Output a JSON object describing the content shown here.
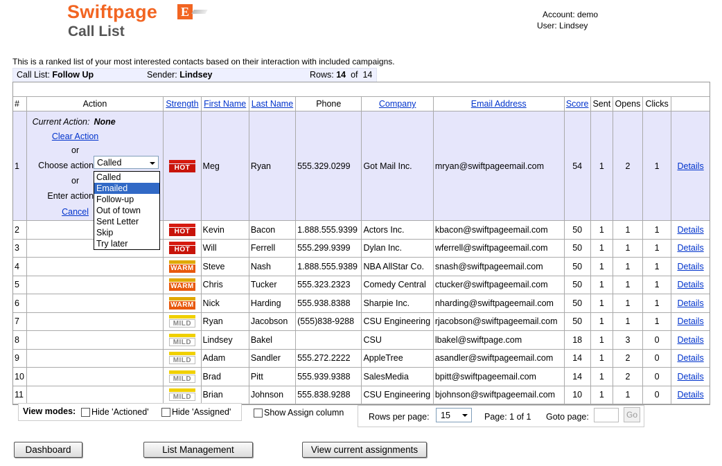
{
  "header": {
    "brand": "Swiftpage",
    "brand_mark": "E",
    "title": "Call List",
    "account_label": "Account:",
    "account": "demo",
    "user_label": "User:",
    "user": "Lindsey"
  },
  "intro": "This is a ranked list of your most interested contacts based on their interaction with included campaigns.",
  "summary": {
    "calllist_label": "Call List:",
    "calllist": "Follow Up",
    "sender_label": "Sender:",
    "sender": "Lindsey",
    "rows_label": "Rows:",
    "rows": "14",
    "of_label": "of",
    "total": "14"
  },
  "columns": [
    "#",
    "Action",
    "Strength",
    "First Name",
    "Last Name",
    "Phone",
    "Company",
    "Email Address",
    "Score",
    "Sent",
    "Opens",
    "Clicks"
  ],
  "action_panel": {
    "current_label": "Current Action:",
    "current_value": "None",
    "clear_label": "Clear Action",
    "or1": "or",
    "choose_label": "Choose action:",
    "or2": "or",
    "enter_label": "Enter action:",
    "cancel_label": "Cancel",
    "selected": "Called",
    "options": [
      "Called",
      "Emailed",
      "Follow-up",
      "Out of town",
      "Sent Letter",
      "Skip",
      "Try later"
    ],
    "highlighted_index": 1
  },
  "details_label": "Details",
  "rows": [
    {
      "num": "1",
      "strength": "HOT",
      "first": "Meg",
      "last": "Ryan",
      "phone": "555.329.0299",
      "company": "Got Mail Inc.",
      "email": "mryan@swiftpageemail.com",
      "score": "54",
      "sent": "1",
      "opens": "2",
      "clicks": "1"
    },
    {
      "num": "2",
      "strength": "HOT",
      "first": "Kevin",
      "last": "Bacon",
      "phone": "1.888.555.9399",
      "company": "Actors Inc.",
      "email": "kbacon@swiftpageemail.com",
      "score": "50",
      "sent": "1",
      "opens": "1",
      "clicks": "1"
    },
    {
      "num": "3",
      "strength": "HOT",
      "first": "Will",
      "last": "Ferrell",
      "phone": "555.299.9399",
      "company": "Dylan Inc.",
      "email": "wferrell@swiftpageemail.com",
      "score": "50",
      "sent": "1",
      "opens": "1",
      "clicks": "1"
    },
    {
      "num": "4",
      "strength": "WARM",
      "first": "Steve",
      "last": "Nash",
      "phone": "1.888.555.9389",
      "company": "NBA AllStar Co.",
      "email": "snash@swiftpageemail.com",
      "score": "50",
      "sent": "1",
      "opens": "1",
      "clicks": "1"
    },
    {
      "num": "5",
      "strength": "WARM",
      "first": "Chris",
      "last": "Tucker",
      "phone": "555.323.2323",
      "company": "Comedy Central",
      "email": "ctucker@swiftpageemail.com",
      "score": "50",
      "sent": "1",
      "opens": "1",
      "clicks": "1"
    },
    {
      "num": "6",
      "strength": "WARM",
      "first": "Nick",
      "last": "Harding",
      "phone": "555.938.8388",
      "company": "Sharpie Inc.",
      "email": "nharding@swiftpageemail.com",
      "score": "50",
      "sent": "1",
      "opens": "1",
      "clicks": "1"
    },
    {
      "num": "7",
      "strength": "MILD",
      "first": "Ryan",
      "last": "Jacobson",
      "phone": "(555)838-9288",
      "company": "CSU Engineering",
      "email": "rjacobson@swiftpageemail.com",
      "score": "50",
      "sent": "1",
      "opens": "1",
      "clicks": "1"
    },
    {
      "num": "8",
      "strength": "MILD",
      "first": "Lindsey",
      "last": "Bakel",
      "phone": "",
      "company": "CSU",
      "email": "lbakel@swiftpage.com",
      "score": "18",
      "sent": "1",
      "opens": "3",
      "clicks": "0"
    },
    {
      "num": "9",
      "strength": "MILD",
      "first": "Adam",
      "last": "Sandler",
      "phone": "555.272.2222",
      "company": "AppleTree",
      "email": "asandler@swiftpageemail.com",
      "score": "14",
      "sent": "1",
      "opens": "2",
      "clicks": "0"
    },
    {
      "num": "10",
      "strength": "MILD",
      "first": "Brad",
      "last": "Pitt",
      "phone": "555.939.9388",
      "company": "SalesMedia",
      "email": "bpitt@swiftpageemail.com",
      "score": "14",
      "sent": "1",
      "opens": "2",
      "clicks": "0"
    },
    {
      "num": "11",
      "strength": "MILD",
      "first": "Brian",
      "last": "Johnson",
      "phone": "555.838.9288",
      "company": "CSU Engineering",
      "email": "bjohnson@swiftpageemail.com",
      "score": "10",
      "sent": "1",
      "opens": "1",
      "clicks": "0"
    }
  ],
  "bottom": {
    "view_modes_label": "View modes:",
    "hide_actioned": "Hide 'Actioned'",
    "hide_assigned": "Hide 'Assigned'",
    "show_assign": "Show Assign column",
    "rows_per_page_label": "Rows per page:",
    "rows_per_page": "15",
    "page_label": "Page: 1 of 1",
    "goto_label": "Goto page:",
    "go_label": "Go"
  },
  "buttons": {
    "dashboard": "Dashboard",
    "list_management": "List Management",
    "view_assignments": "View current assignments"
  },
  "colors": {
    "brand_orange": "#f26522",
    "link_blue": "#0033cc",
    "selected_row": "#e6e6fb",
    "hot": "#c8140a",
    "warm": "#e8580c",
    "mild": "#f0d000"
  }
}
